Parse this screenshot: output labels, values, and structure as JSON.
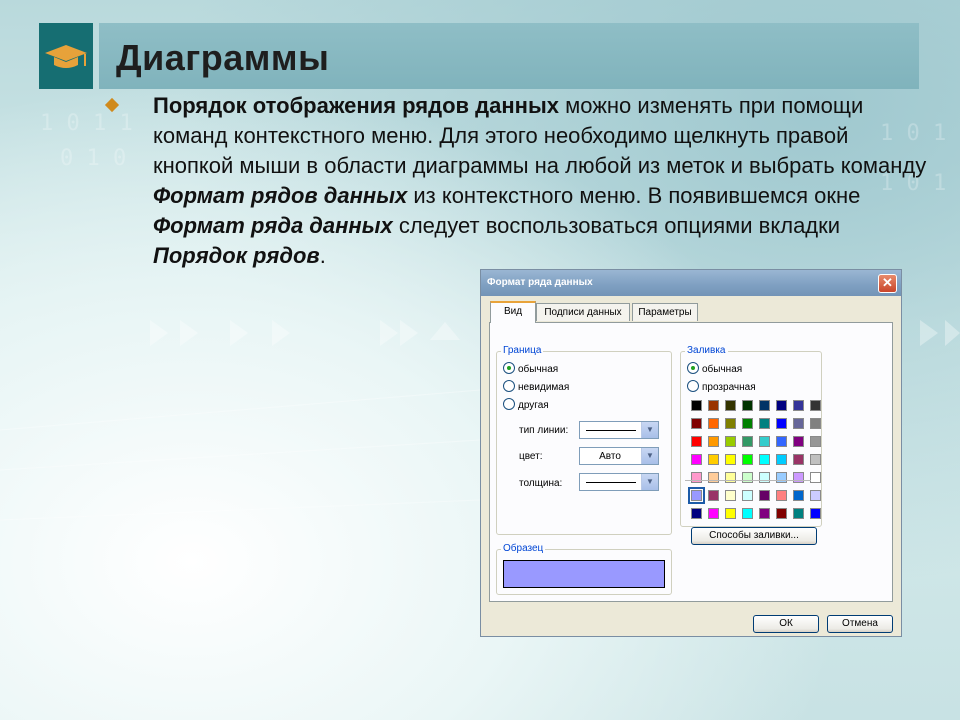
{
  "slide": {
    "title": "Диаграммы",
    "bullet_parts": [
      {
        "text": "Порядок отображения рядов данных",
        "style": "bold"
      },
      {
        "text": " можно изменять при помощи команд контекстного меню. Для этого необходимо щелкнуть правой кнопкой мыши в области диаграммы на любой из меток и выбрать команду ",
        "style": "normal"
      },
      {
        "text": "Формат рядов данных",
        "style": "bold-italic"
      },
      {
        "text": " из контекстного меню. В появившемся окне ",
        "style": "normal"
      },
      {
        "text": "Формат ряда данных",
        "style": "bold-italic"
      },
      {
        "text": " следует воспользоваться опциями вкладки ",
        "style": "normal"
      },
      {
        "text": "Порядок рядов",
        "style": "bold-italic"
      },
      {
        "text": ".",
        "style": "normal"
      }
    ]
  },
  "dialog": {
    "title": "Формат ряда данных",
    "close_glyph": "✕",
    "tabs": [
      {
        "label": "Вид",
        "active": true
      },
      {
        "label": "Подписи данных",
        "active": false
      },
      {
        "label": "Параметры",
        "active": false
      }
    ],
    "border_group": {
      "label": "Граница",
      "options": [
        {
          "label": "обычная",
          "selected": true
        },
        {
          "label": "невидимая",
          "selected": false
        },
        {
          "label": "другая",
          "selected": false
        }
      ],
      "line_type_label": "тип линии:",
      "color_label": "цвет:",
      "color_value": "Авто",
      "weight_label": "толщина:"
    },
    "sample_group": {
      "label": "Образец",
      "sample_color": "#9999ff"
    },
    "fill_group": {
      "label": "Заливка",
      "options": [
        {
          "label": "обычная",
          "selected": true
        },
        {
          "label": "прозрачная",
          "selected": false
        }
      ],
      "palette_main": [
        [
          "#000000",
          "#993300",
          "#333300",
          "#003300",
          "#003366",
          "#000080",
          "#333399",
          "#333333"
        ],
        [
          "#800000",
          "#ff6600",
          "#808000",
          "#008000",
          "#008080",
          "#0000ff",
          "#666699",
          "#808080"
        ],
        [
          "#ff0000",
          "#ff9900",
          "#99cc00",
          "#339966",
          "#33cccc",
          "#3366ff",
          "#800080",
          "#969696"
        ],
        [
          "#ff00ff",
          "#ffcc00",
          "#ffff00",
          "#00ff00",
          "#00ffff",
          "#00ccff",
          "#993366",
          "#c0c0c0"
        ],
        [
          "#ff99cc",
          "#ffcc99",
          "#ffff99",
          "#ccffcc",
          "#ccffff",
          "#99ccff",
          "#cc99ff",
          "#ffffff"
        ]
      ],
      "palette_chart": [
        [
          "#9999ff",
          "#993366",
          "#ffffcc",
          "#ccffff",
          "#660066",
          "#ff8080",
          "#0066cc",
          "#ccccff"
        ],
        [
          "#000080",
          "#ff00ff",
          "#ffff00",
          "#00ffff",
          "#800080",
          "#800000",
          "#008080",
          "#0000ff"
        ]
      ],
      "fill_effects_label": "Способы заливки..."
    },
    "ok_label": "ОК",
    "cancel_label": "Отмена"
  },
  "colors": {
    "title_bar": "#86b8c0",
    "logo_bg": "#166e72",
    "logo_cap": "#e7a23a",
    "bullet": "#d08a1c"
  }
}
